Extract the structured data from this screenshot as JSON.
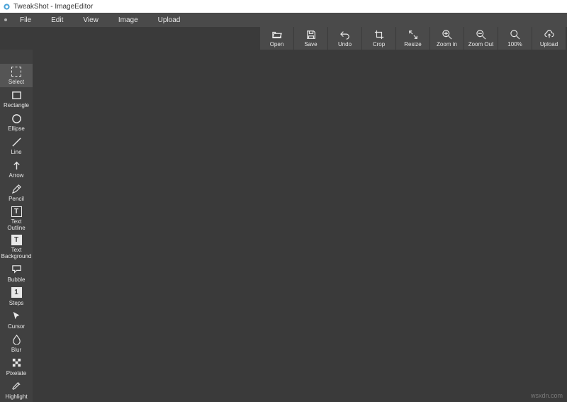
{
  "window": {
    "title": "TweakShot - ImageEditor"
  },
  "menu": {
    "items": [
      "File",
      "Edit",
      "View",
      "Image",
      "Upload"
    ]
  },
  "topbar": {
    "open": {
      "label": "Open"
    },
    "save": {
      "label": "Save"
    },
    "undo": {
      "label": "Undo"
    },
    "crop": {
      "label": "Crop"
    },
    "resize": {
      "label": "Resize"
    },
    "zoomin": {
      "label": "Zoom in"
    },
    "zoomout": {
      "label": "Zoom Out"
    },
    "zoom100": {
      "label": "100%"
    },
    "upload": {
      "label": "Upload"
    }
  },
  "tools": {
    "select": {
      "label": "Select"
    },
    "rectangle": {
      "label": "Rectangle"
    },
    "ellipse": {
      "label": "Ellipse"
    },
    "line": {
      "label": "Line"
    },
    "arrow": {
      "label": "Arrow"
    },
    "pencil": {
      "label": "Pencil"
    },
    "textoutline": {
      "label": "Text\nOutline"
    },
    "textbackground": {
      "label": "Text\nBackground"
    },
    "bubble": {
      "label": "Bubble"
    },
    "steps": {
      "label": "Steps"
    },
    "cursor": {
      "label": "Cursor"
    },
    "blur": {
      "label": "Blur"
    },
    "pixelate": {
      "label": "Pixelate"
    },
    "highlight": {
      "label": "Highlight"
    }
  },
  "watermark": "wsxdn.com"
}
